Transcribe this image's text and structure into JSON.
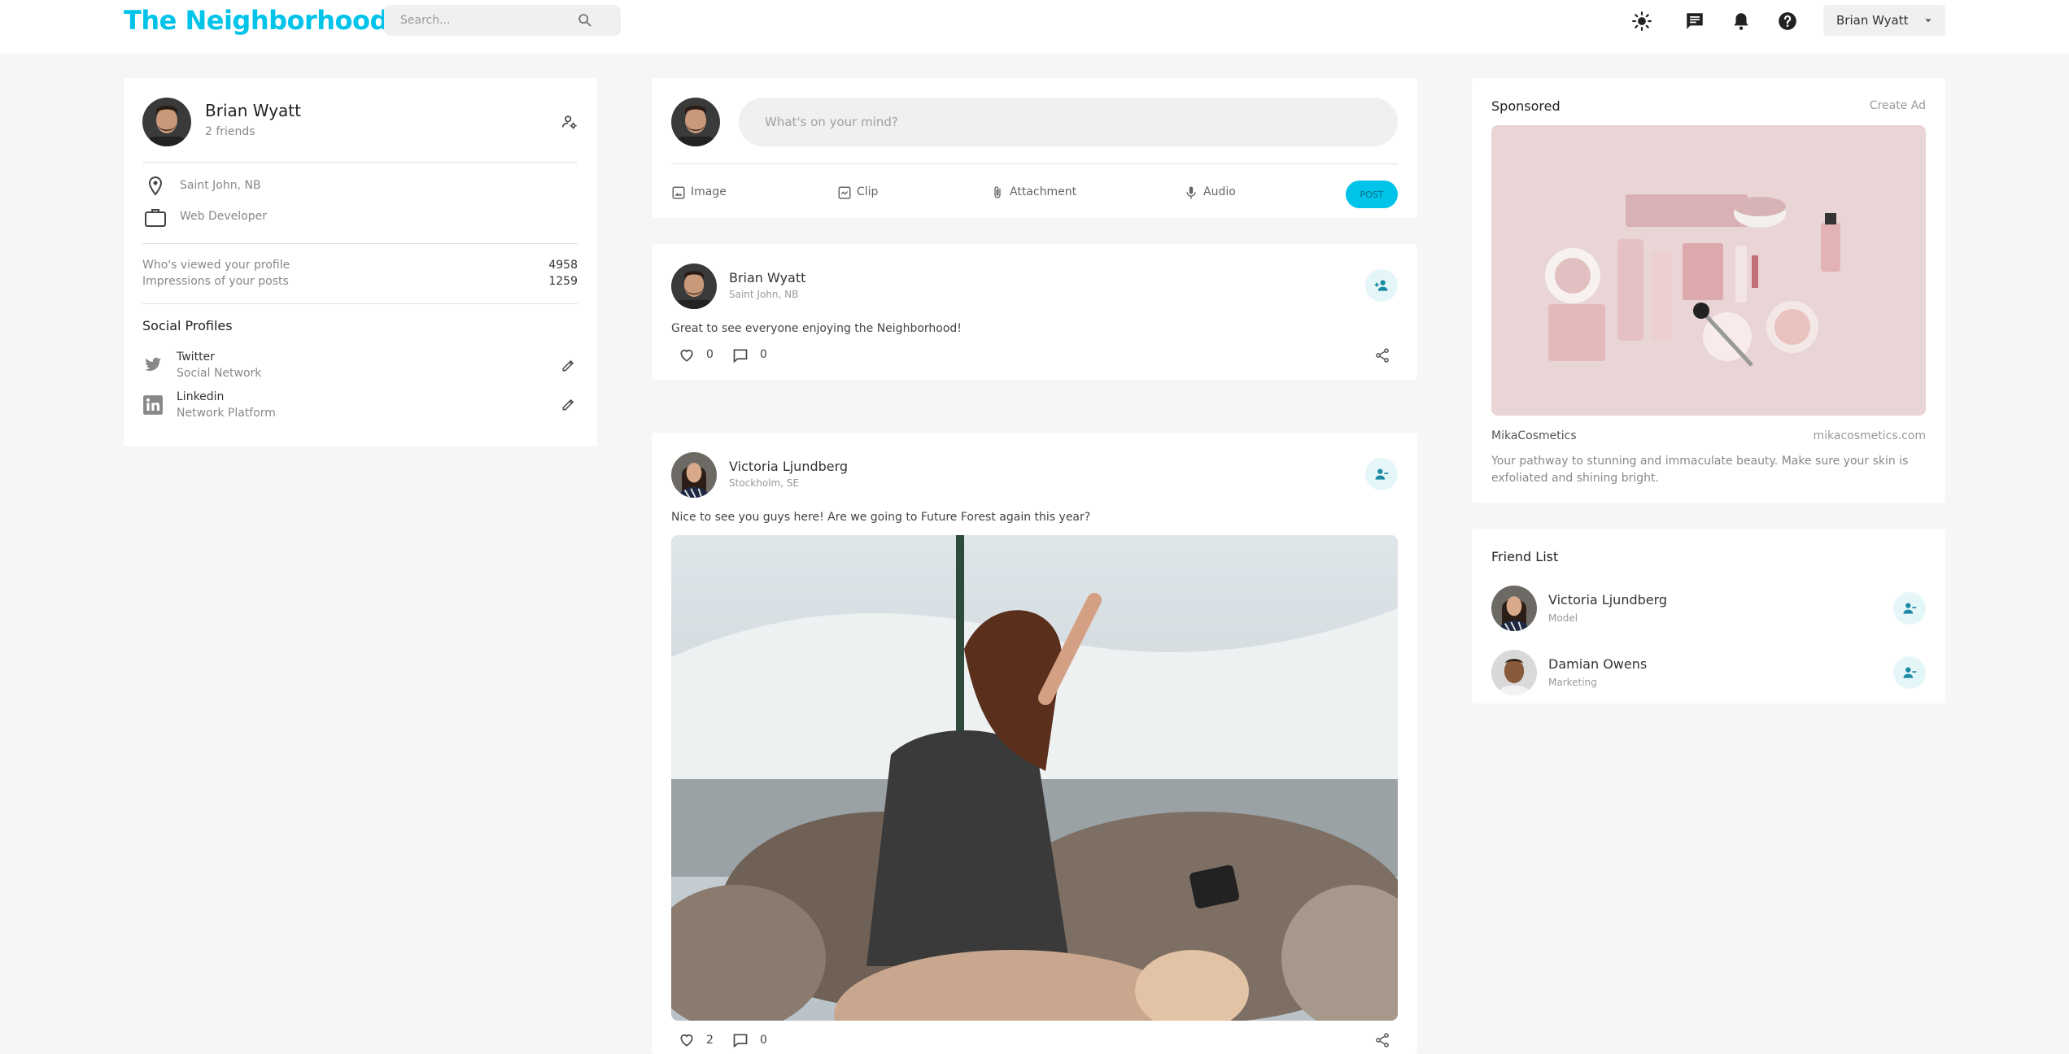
{
  "header": {
    "brand": "The Neighborhood",
    "search_placeholder": "Search...",
    "user_menu_label": "Brian Wyatt",
    "icons": [
      "light-mode-icon",
      "messages-icon",
      "notifications-icon",
      "help-icon"
    ]
  },
  "profile": {
    "name": "Brian Wyatt",
    "friends": "2 friends",
    "location": "Saint John, NB",
    "occupation": "Web Developer",
    "stats": [
      {
        "label": "Who's viewed your profile",
        "value": "4958"
      },
      {
        "label": "Impressions of your posts",
        "value": "1259"
      }
    ],
    "social_title": "Social Profiles",
    "socials": [
      {
        "name": "Twitter",
        "sub": "Social Network",
        "icon": "twitter-icon"
      },
      {
        "name": "Linkedin",
        "sub": "Network Platform",
        "icon": "linkedin-icon"
      }
    ]
  },
  "composer": {
    "placeholder": "What's on your mind?",
    "tools": [
      "Image",
      "Clip",
      "Attachment",
      "Audio"
    ],
    "post_label": "POST"
  },
  "posts": [
    {
      "author": "Brian Wyatt",
      "location": "Saint John, NB",
      "text": "Great to see everyone enjoying the Neighborhood!",
      "likes": "0",
      "comments": "0",
      "friend_action_icon": "add-friend-icon"
    },
    {
      "author": "Victoria Ljundberg",
      "location": "Stockholm, SE",
      "text": "Nice to see you guys here! Are we going to Future Forest again this year?",
      "likes": "2",
      "comments": "0",
      "friend_action_icon": "remove-friend-icon",
      "image": "festival-crowd-photo"
    }
  ],
  "sponsored": {
    "title": "Sponsored",
    "create_ad": "Create Ad",
    "brand": "MikaCosmetics",
    "url": "mikacosmetics.com",
    "description": "Your pathway to stunning and immaculate beauty. Make sure your skin is exfoliated and shining bright.",
    "image": "cosmetics-products-photo"
  },
  "friend_list": {
    "title": "Friend List",
    "friends": [
      {
        "name": "Victoria Ljundberg",
        "role": "Model"
      },
      {
        "name": "Damian Owens",
        "role": "Marketing"
      }
    ]
  },
  "colors": {
    "accent": "#00c3ea",
    "background": "#f6f6f6",
    "card": "#ffffff",
    "muted_text": "#888888"
  }
}
